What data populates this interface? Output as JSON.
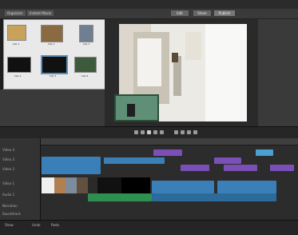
{
  "menubar": {
    "tabs": [
      "Organizer",
      "Instant Movie"
    ],
    "buttons": [
      "Edit",
      "Share",
      "Publish"
    ]
  },
  "left_panel": {
    "thumbnails": [
      {
        "label": "Clip 1"
      },
      {
        "label": "Clip 2"
      },
      {
        "label": "Clip 3"
      },
      {
        "label": "Clip 4"
      },
      {
        "label": "Clip 5"
      },
      {
        "label": "Clip 6"
      }
    ]
  },
  "timeline": {
    "tracks": [
      "Video 4",
      "Video 3",
      "Video 2",
      "Video 1",
      "Audio 1",
      "Narration",
      "Soundtrack"
    ]
  },
  "status": {
    "buttons": [
      "Show",
      "Undo",
      "Redo"
    ]
  },
  "colors": {
    "clip_blue": "#3b7fb8",
    "clip_purple": "#7a50b6",
    "clip_green": "#2f8f4f",
    "selected_teal": "#4aa0d0"
  }
}
